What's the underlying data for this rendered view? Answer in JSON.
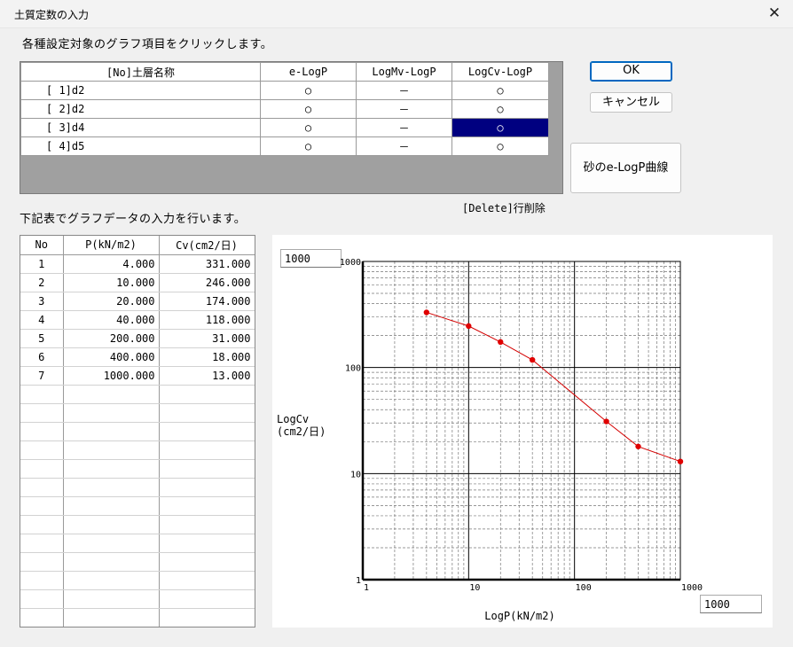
{
  "window": {
    "title": "土質定数の入力",
    "close_glyph": "✕"
  },
  "instructions": {
    "top": "各種設定対象のグラフ項目をクリックします。",
    "bottom": "下記表でグラフデータの入力を行います。"
  },
  "layer_table": {
    "headers": [
      "[No]土層名称",
      "e-LogP",
      "LogMv-LogP",
      "LogCv-LogP"
    ],
    "rows": [
      {
        "name": "[ 1]d2",
        "e": "○",
        "mv": "－",
        "cv": "○"
      },
      {
        "name": "[ 2]d2",
        "e": "○",
        "mv": "－",
        "cv": "○"
      },
      {
        "name": "[ 3]d4",
        "e": "○",
        "mv": "－",
        "cv": "○"
      },
      {
        "name": "[ 4]d5",
        "e": "○",
        "mv": "－",
        "cv": "○"
      }
    ],
    "selected_row": 2,
    "selected_col": "LogCv-LogP",
    "selection_color": "#000080"
  },
  "buttons": {
    "ok": "OK",
    "cancel": "キャンセル",
    "sand_curve": "砂のe-LogP曲線"
  },
  "delete_hint": "[Delete]行削除",
  "data_table": {
    "headers": [
      "No",
      "P(kN/m2)",
      "Cv(cm2/日)"
    ],
    "rows": [
      {
        "no": "1",
        "p": "4.000",
        "cv": "331.000"
      },
      {
        "no": "2",
        "p": "10.000",
        "cv": "246.000"
      },
      {
        "no": "3",
        "p": "20.000",
        "cv": "174.000"
      },
      {
        "no": "4",
        "p": "40.000",
        "cv": "118.000"
      },
      {
        "no": "5",
        "p": "200.000",
        "cv": "31.000"
      },
      {
        "no": "6",
        "p": "400.000",
        "cv": "18.000"
      },
      {
        "no": "7",
        "p": "1000.000",
        "cv": "13.000"
      }
    ],
    "empty_rows": 13
  },
  "axis_inputs": {
    "y_max": "1000",
    "x_max": "1000"
  },
  "chart_data": {
    "type": "line",
    "x_scale": "log",
    "y_scale": "log",
    "xlim": [
      1,
      1000
    ],
    "ylim": [
      1,
      1000
    ],
    "xlabel": "LogP(kN/m2)",
    "ylabel_lines": [
      "LogCv",
      "(cm2/日)"
    ],
    "x_ticks": [
      "1",
      "10",
      "100",
      "1000"
    ],
    "y_ticks": [
      "1",
      "10",
      "100",
      "1000"
    ],
    "grid": true,
    "series": [
      {
        "x": [
          4,
          10,
          20,
          40,
          200,
          400,
          1000
        ],
        "y": [
          331,
          246,
          174,
          118,
          31,
          18,
          13
        ]
      }
    ],
    "line_color": "#d40000",
    "marker_color": "#e00000"
  }
}
